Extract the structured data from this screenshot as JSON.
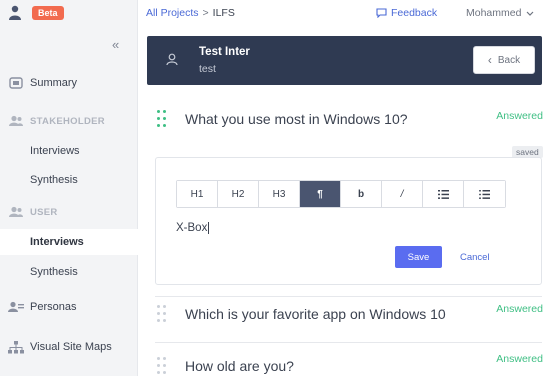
{
  "brand": {
    "badge": "Beta",
    "accent": "#f26b4f"
  },
  "sidebar": {
    "collapse_glyph": "«",
    "items": [
      {
        "label": "Summary",
        "icon": "summary-icon"
      },
      {
        "label": "STAKEHOLDER",
        "icon": "users-icon"
      },
      {
        "label": "Interviews"
      },
      {
        "label": "Synthesis"
      },
      {
        "label": "USER",
        "icon": "users-icon"
      },
      {
        "label": "Interviews",
        "active": true
      },
      {
        "label": "Synthesis"
      },
      {
        "label": "Personas",
        "icon": "personas-icon"
      },
      {
        "label": "Visual Site Maps",
        "icon": "sitemap-icon"
      }
    ]
  },
  "topbar": {
    "crumb_root": "All Projects",
    "crumb_sep": ">",
    "crumb_current": "ILFS",
    "feedback": "Feedback",
    "user": "Mohammed"
  },
  "header": {
    "title": "Test Inter",
    "subtitle": "test",
    "back_label": "Back"
  },
  "questions": [
    {
      "text": "What you use most in Windows 10?",
      "status": "Answered"
    },
    {
      "text": "Which is your favorite app on Windows 10",
      "status": "Answered"
    },
    {
      "text": "How old are you?",
      "status": "Answered"
    }
  ],
  "editor": {
    "saved_badge": "saved",
    "toolbar": [
      "H1",
      "H2",
      "H3",
      "¶",
      "b",
      "/",
      "list-ordered",
      "list-bulleted"
    ],
    "value": "X-Box",
    "save_label": "Save",
    "cancel_label": "Cancel"
  },
  "colors": {
    "answered": "#3fbf84",
    "header_bg": "#2f3a52",
    "primary": "#5a6cf0",
    "link": "#4a69d6"
  }
}
